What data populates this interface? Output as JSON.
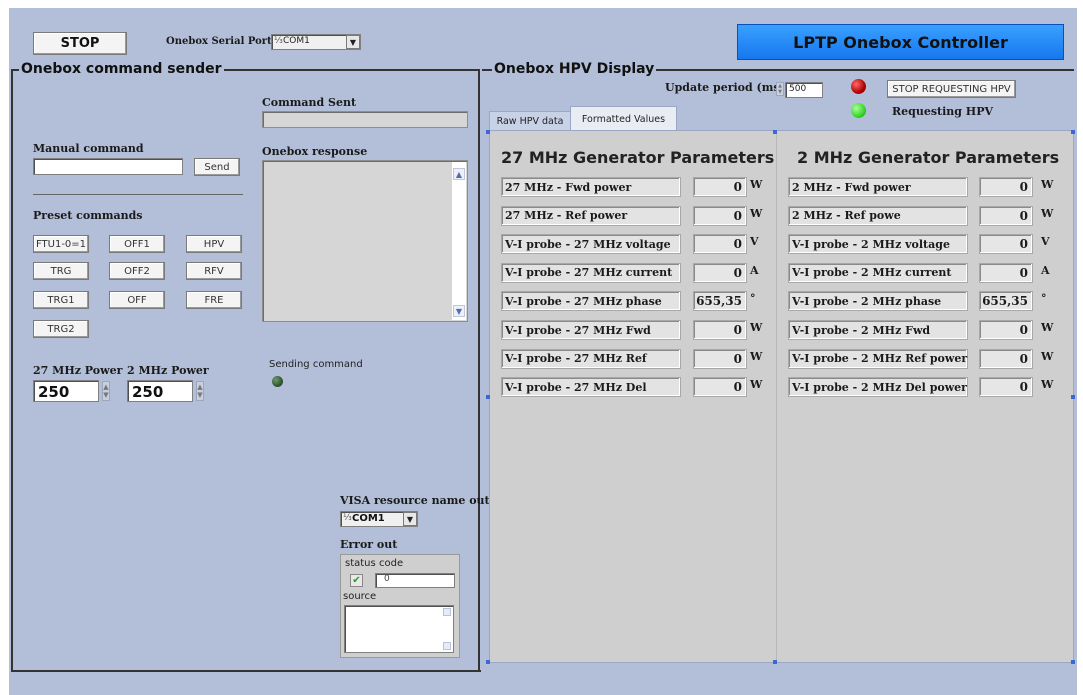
{
  "toolbar": {
    "stop_label": "STOP",
    "serial_port_label": "Onebox Serial Port",
    "serial_port_value": "COM1",
    "app_title": "LPTP Onebox Controller"
  },
  "sender": {
    "section_title": "Onebox command sender",
    "command_sent_label": "Command Sent",
    "command_sent_value": "",
    "manual_command_label": "Manual command",
    "manual_command_value": "",
    "send_label": "Send",
    "response_label": "Onebox response",
    "response_value": "",
    "preset_label": "Preset commands",
    "presets": [
      "FTU1-0=1",
      "OFF1",
      "HPV",
      "TRG",
      "OFF2",
      "RFV",
      "TRG1",
      "OFF",
      "FRE",
      "TRG2"
    ],
    "power27_label": "27 MHz Power",
    "power27_value": "250",
    "power2_label": "2 MHz Power",
    "power2_value": "250",
    "sending_label": "Sending command",
    "visa_label": "VISA resource name out",
    "visa_value": "COM1",
    "error_out_label": "Error out",
    "status_label": "status",
    "code_label": "code",
    "code_value": "0",
    "source_label": "source",
    "source_value": ""
  },
  "hpv": {
    "section_title": "Onebox HPV Display",
    "update_period_label": "Update period (ms)",
    "update_period_value": "500",
    "stop_requesting_label": "STOP REQUESTING HPV",
    "requesting_label": "Requesting HPV",
    "tabs": [
      "Raw HPV data",
      "Formatted Values"
    ],
    "active_tab": "Formatted Values",
    "gen27": {
      "title": "27 MHz Generator Parameters",
      "rows": [
        {
          "name": "27 MHz - Fwd power",
          "value": "0",
          "unit": "W"
        },
        {
          "name": "27 MHz - Ref power",
          "value": "0",
          "unit": "W"
        },
        {
          "name": "V-I probe - 27 MHz voltage",
          "value": "0",
          "unit": "V"
        },
        {
          "name": "V-I probe - 27 MHz current",
          "value": "0",
          "unit": "A"
        },
        {
          "name": "V-I probe - 27 MHz phase",
          "value": "655,35",
          "unit": "°"
        },
        {
          "name": "V-I probe - 27 MHz Fwd",
          "value": "0",
          "unit": "W"
        },
        {
          "name": "V-I probe - 27 MHz Ref",
          "value": "0",
          "unit": "W"
        },
        {
          "name": "V-I probe - 27 MHz Del",
          "value": "0",
          "unit": "W"
        }
      ]
    },
    "gen2": {
      "title": "2 MHz Generator Parameters",
      "rows": [
        {
          "name": "2 MHz - Fwd power",
          "value": "0",
          "unit": "W"
        },
        {
          "name": "2 MHz - Ref powe",
          "value": "0",
          "unit": "W"
        },
        {
          "name": "V-I probe - 2 MHz voltage",
          "value": "0",
          "unit": "V"
        },
        {
          "name": "V-I probe - 2 MHz current",
          "value": "0",
          "unit": "A"
        },
        {
          "name": "V-I probe - 2 MHz phase",
          "value": "655,35",
          "unit": "°"
        },
        {
          "name": "V-I probe - 2 MHz Fwd",
          "value": "0",
          "unit": "W"
        },
        {
          "name": "V-I probe - 2 MHz Ref power",
          "value": "0",
          "unit": "W"
        },
        {
          "name": "V-I probe - 2 MHz Del power",
          "value": "0",
          "unit": "W"
        }
      ]
    }
  },
  "colors": {
    "panel_bg": "#b3bfd9",
    "title_bar": "#1e90ff",
    "led_red": "#b00000",
    "led_green": "#39d62a",
    "led_dark": "#2f5a2f"
  }
}
